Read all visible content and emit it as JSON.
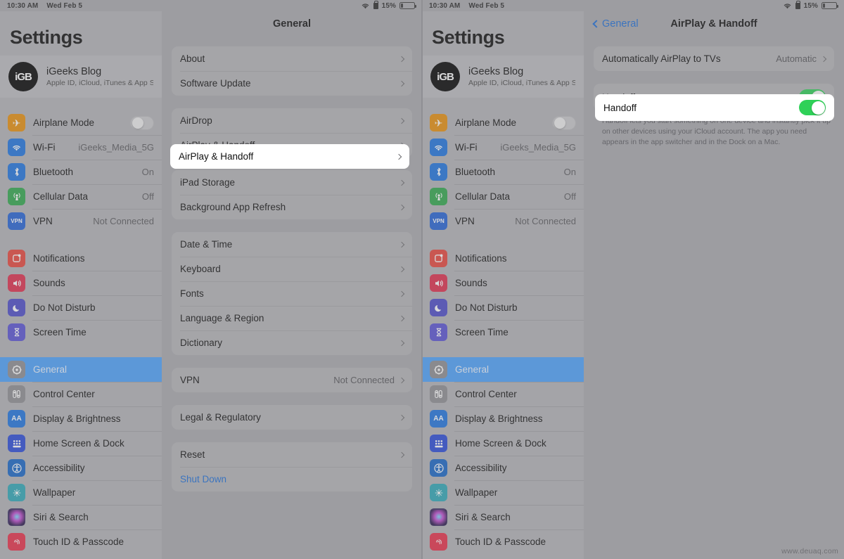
{
  "status_bar": {
    "time": "10:30 AM",
    "date": "Wed Feb 5",
    "battery_percent": "15%",
    "wifi_icon": "wifi-icon",
    "lock_icon": "rotation-lock-icon",
    "battery_icon": "battery-icon"
  },
  "sidebar": {
    "title": "Settings",
    "account": {
      "name": "iGeeks Blog",
      "subtitle": "Apple ID, iCloud, iTunes & App St...",
      "avatar_text": "iGB"
    },
    "group1": [
      {
        "label": "Airplane Mode",
        "value": "",
        "icon": "airplane-icon",
        "glyph": "✈",
        "color": "#e8900c",
        "control": "toggle-off"
      },
      {
        "label": "Wi-Fi",
        "value": "iGeeks_Media_5G",
        "icon": "wifi-icon",
        "glyph": "◑",
        "color": "#1f75e0",
        "control": "chevron"
      },
      {
        "label": "Bluetooth",
        "value": "On",
        "icon": "bluetooth-icon",
        "glyph": "ᛣ",
        "color": "#1f75e0",
        "control": "chevron"
      },
      {
        "label": "Cellular Data",
        "value": "Off",
        "icon": "cellular-icon",
        "glyph": "ʖ",
        "color": "#30a84d",
        "control": "chevron"
      },
      {
        "label": "VPN",
        "value": "Not Connected",
        "icon": "vpn-icon",
        "glyph": "VPN",
        "color": "#2563d6",
        "control": "chevron"
      }
    ],
    "group2": [
      {
        "label": "Notifications",
        "icon": "notifications-icon",
        "glyph": "▢",
        "color": "#e8463c"
      },
      {
        "label": "Sounds",
        "icon": "sounds-icon",
        "glyph": "🔊",
        "color": "#e02e4d"
      },
      {
        "label": "Do Not Disturb",
        "icon": "do-not-disturb-icon",
        "glyph": "☽",
        "color": "#4d4bc9"
      },
      {
        "label": "Screen Time",
        "icon": "screen-time-icon",
        "glyph": "⧖",
        "color": "#5a52d5"
      }
    ],
    "group3": [
      {
        "label": "General",
        "icon": "gear-icon",
        "glyph": "⚙",
        "color": "#8e8e93",
        "selected": true
      },
      {
        "label": "Control Center",
        "icon": "control-center-icon",
        "glyph": "☷",
        "color": "#8e8e93"
      },
      {
        "label": "Display & Brightness",
        "icon": "display-brightness-icon",
        "glyph": "AA",
        "color": "#1f75e0"
      },
      {
        "label": "Home Screen & Dock",
        "icon": "home-screen-dock-icon",
        "glyph": "▒",
        "color": "#2a4bd8"
      },
      {
        "label": "Accessibility",
        "icon": "accessibility-icon",
        "glyph": "Ⓙ",
        "color": "#1766c8"
      },
      {
        "label": "Wallpaper",
        "icon": "wallpaper-icon",
        "glyph": "✿",
        "color": "#2fa8b8"
      },
      {
        "label": "Siri & Search",
        "icon": "siri-search-icon",
        "glyph": "◉",
        "color": "#4a3a7a"
      },
      {
        "label": "Touch ID & Passcode",
        "icon": "touch-id-icon",
        "glyph": "◎",
        "color": "#e8304a"
      }
    ]
  },
  "general_pane": {
    "title": "General",
    "cards": [
      {
        "rows": [
          {
            "label": "About",
            "value": "",
            "type": "chevron"
          },
          {
            "label": "Software Update",
            "value": "",
            "type": "chevron"
          }
        ]
      },
      {
        "rows": [
          {
            "label": "AirDrop",
            "value": "",
            "type": "chevron"
          },
          {
            "label": "AirPlay & Handoff",
            "value": "",
            "type": "chevron",
            "highlighted": true
          }
        ]
      },
      {
        "rows": [
          {
            "label": "iPad Storage",
            "value": "",
            "type": "chevron"
          },
          {
            "label": "Background App Refresh",
            "value": "",
            "type": "chevron"
          }
        ]
      },
      {
        "rows": [
          {
            "label": "Date & Time",
            "value": "",
            "type": "chevron"
          },
          {
            "label": "Keyboard",
            "value": "",
            "type": "chevron"
          },
          {
            "label": "Fonts",
            "value": "",
            "type": "chevron"
          },
          {
            "label": "Language & Region",
            "value": "",
            "type": "chevron"
          },
          {
            "label": "Dictionary",
            "value": "",
            "type": "chevron"
          }
        ]
      },
      {
        "rows": [
          {
            "label": "VPN",
            "value": "Not Connected",
            "type": "chevron"
          }
        ]
      },
      {
        "rows": [
          {
            "label": "Legal & Regulatory",
            "value": "",
            "type": "chevron"
          }
        ]
      },
      {
        "rows": [
          {
            "label": "Reset",
            "value": "",
            "type": "chevron"
          },
          {
            "label": "Shut Down",
            "value": "",
            "type": "link"
          }
        ]
      }
    ]
  },
  "airplay_pane": {
    "back_label": "General",
    "title": "AirPlay & Handoff",
    "row_airplay_label": "Automatically AirPlay to TVs",
    "row_airplay_value": "Automatic",
    "row_handoff_label": "Handoff",
    "handoff_toggle_state": "on",
    "handoff_toggle_color": "#2fd158",
    "footer_note": "Handoff lets you start something on one device and instantly pick it up on other devices using your iCloud account. The app you need appears in the app switcher and in the Dock on a Mac."
  },
  "watermark": "www.deuaq.com"
}
